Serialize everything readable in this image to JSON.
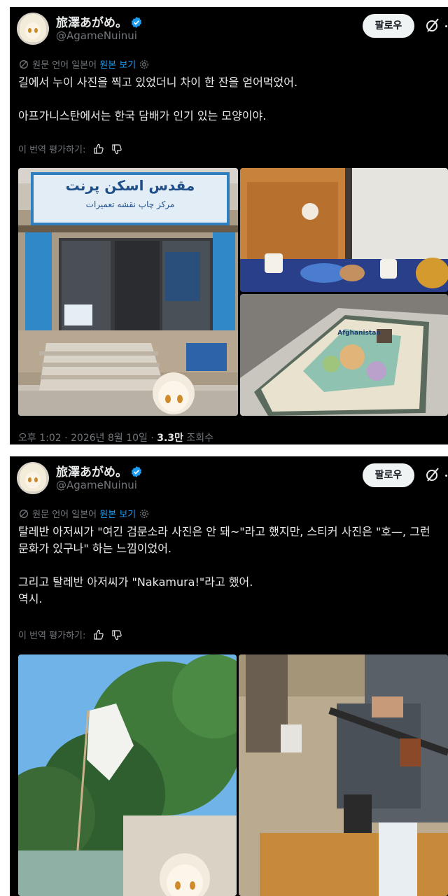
{
  "posts": [
    {
      "author_name": "旅澤あがめ。",
      "handle": "@AgameNuinui",
      "follow_label": "팔로우",
      "translation_note": "원문 언어 일본어",
      "show_original": "원본 보기",
      "text_lines": [
        "길에서 누이 사진을 찍고 있었더니 차이 한 잔을 얻어먹었어.",
        "",
        "아프가니스탄에서는 한국 담배가 인기 있는 모양이야."
      ],
      "rate_label": "이 번역 평가하기:",
      "timestamp": "오후 1:02 · 2026년 8월 10일 · ",
      "views_count": "3.3만",
      "views_label": " 조회수",
      "shop_sign_main": "مقدس اسکن پرنت",
      "shop_sign_sub": "مرکز چاپ نقشه تعمیرات",
      "map_title": "Afghanistan"
    },
    {
      "author_name": "旅澤あがめ。",
      "handle": "@AgameNuinui",
      "follow_label": "팔로우",
      "translation_note": "원문 언어 일본어",
      "show_original": "원본 보기",
      "text_lines": [
        "탈레반 아저씨가 \"여긴 검문소라 사진은 안 돼~\"라고 했지만, 스티커 사진은 \"호—, 그런",
        "문화가 있구나\" 하는 느낌이었어.",
        "",
        "그리고 탈레반 아저씨가 \"Nakamura!\"라고 했어.",
        "역시."
      ],
      "rate_label": "이 번역 평가하기:"
    }
  ],
  "colors": {
    "background": "#000000",
    "text": "#e7e9ea",
    "muted": "#71767b",
    "link": "#1d9bf0",
    "verified": "#1d9bf0",
    "follow_bg": "#eff3f4"
  },
  "icons": [
    "verified-badge-icon",
    "grok-icon",
    "translate-icon",
    "gear-icon",
    "thumbs-up-icon",
    "thumbs-down-icon"
  ]
}
